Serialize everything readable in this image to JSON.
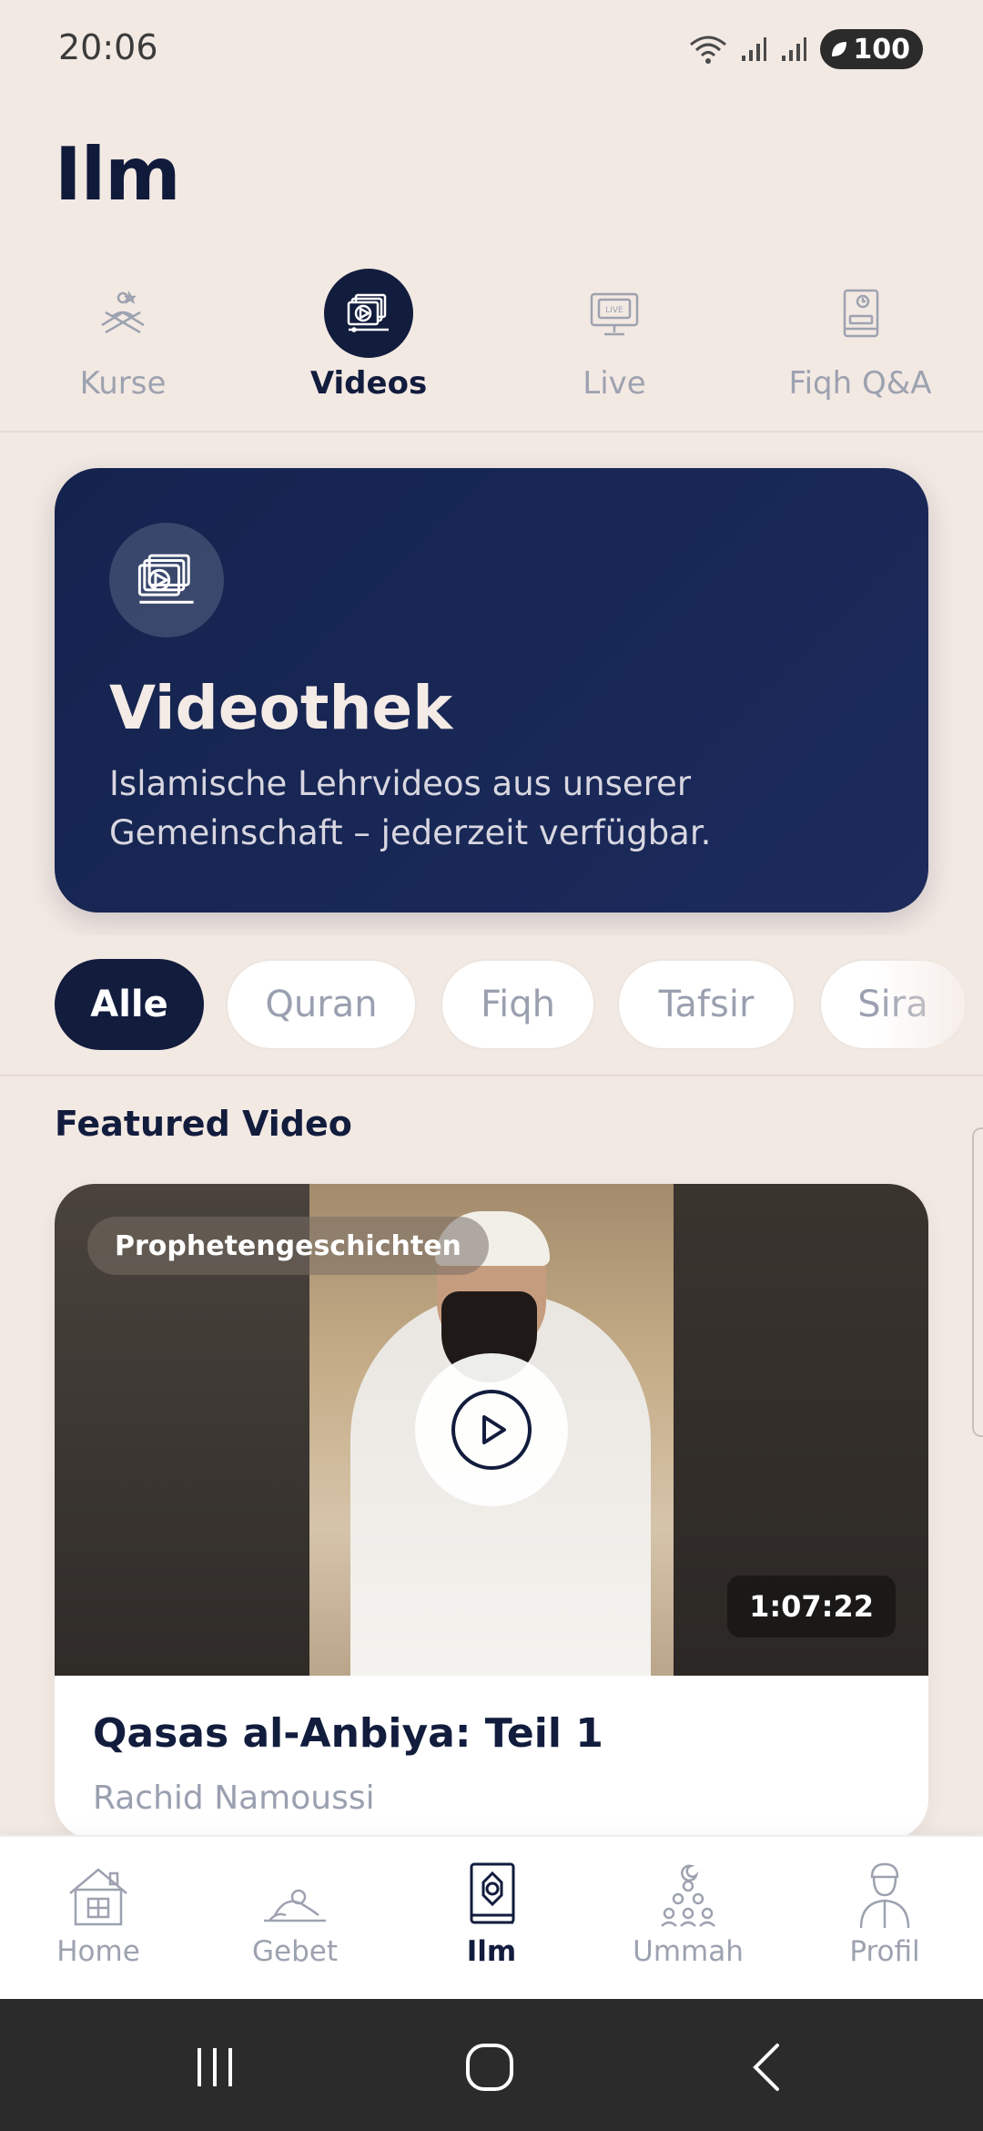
{
  "status_bar": {
    "time": "20:06",
    "battery": "100"
  },
  "page": {
    "title": "Ilm"
  },
  "top_tabs": [
    {
      "label": "Kurse",
      "icon": "quran-stand-icon",
      "active": false
    },
    {
      "label": "Videos",
      "icon": "video-library-icon",
      "active": true
    },
    {
      "label": "Live",
      "icon": "live-tv-icon",
      "active": false
    },
    {
      "label": "Fiqh Q&A",
      "icon": "book-question-icon",
      "active": false
    }
  ],
  "hero": {
    "title": "Videothek",
    "subtitle": "Islamische Lehrvideos aus unserer Gemeinschaft – jederzeit verfügbar."
  },
  "filters": {
    "chips": [
      "Alle",
      "Quran",
      "Fiqh",
      "Tafsir",
      "Sira"
    ],
    "selected": "Alle"
  },
  "featured": {
    "section_title": "Featured Video",
    "category": "Prophetengeschichten",
    "duration": "1:07:22",
    "title": "Qasas al-Anbiya: Teil 1",
    "author": "Rachid Namoussi"
  },
  "bottom_nav": [
    {
      "label": "Home",
      "icon": "house-icon",
      "active": false
    },
    {
      "label": "Gebet",
      "icon": "prayer-icon",
      "active": false
    },
    {
      "label": "Ilm",
      "icon": "quran-book-icon",
      "active": true
    },
    {
      "label": "Ummah",
      "icon": "community-icon",
      "active": false
    },
    {
      "label": "Profil",
      "icon": "profile-icon",
      "active": false
    }
  ],
  "colors": {
    "background": "#f3e9e3",
    "navy": "#121c3d",
    "muted": "#9da2b0"
  }
}
